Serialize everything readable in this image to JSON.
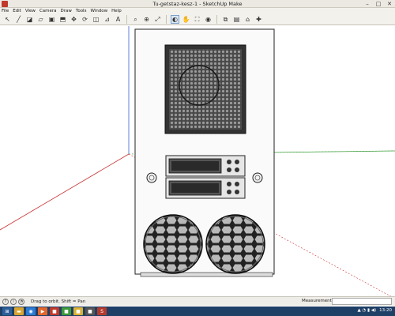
{
  "window": {
    "title": "Tu-getstaz-kesz-1 - SketchUp Make",
    "minimize": "–",
    "maximize": "□",
    "close": "✕"
  },
  "menu": [
    "File",
    "Edit",
    "View",
    "Camera",
    "Draw",
    "Tools",
    "Window",
    "Help"
  ],
  "toolbar": {
    "tools": [
      {
        "name": "select-tool",
        "icon": "↖"
      },
      {
        "name": "line-tool",
        "icon": "╱"
      },
      {
        "name": "shape-tool",
        "icon": "◪"
      },
      {
        "name": "eraser-tool",
        "icon": "▱"
      },
      {
        "name": "paint-tool",
        "icon": "▣"
      },
      {
        "name": "push-pull-tool",
        "icon": "⬒"
      },
      {
        "name": "move-tool",
        "icon": "✥"
      },
      {
        "name": "rotate-tool",
        "icon": "⟳"
      },
      {
        "name": "offset-tool",
        "icon": "◫"
      },
      {
        "name": "tape-tool",
        "icon": "⊿"
      },
      {
        "name": "text-tool",
        "icon": "A"
      },
      {
        "name": "zoom-tool",
        "icon": "⌕"
      },
      {
        "name": "zoom-window-tool",
        "icon": "⊕"
      },
      {
        "name": "zoom-extents-tool",
        "icon": "⤢"
      },
      {
        "name": "orbit-tool",
        "icon": "◐"
      },
      {
        "name": "pan-tool",
        "icon": "✋"
      },
      {
        "name": "walk-tool",
        "icon": "⛶"
      },
      {
        "name": "position-camera-tool",
        "icon": "◉"
      },
      {
        "name": "section-tool",
        "icon": "⧉"
      },
      {
        "name": "scenes-tool",
        "icon": "▤"
      },
      {
        "name": "warehouse-tool",
        "icon": "⌂"
      },
      {
        "name": "extensions-tool",
        "icon": "✚"
      }
    ],
    "active_tool": "orbit-tool"
  },
  "statusbar": {
    "hint": "Drag to orbit.  Shift = Pan",
    "measurements_label": "Measurements",
    "measurements_value": ""
  },
  "taskbar": {
    "apps": [
      {
        "name": "start",
        "icon": "⊞",
        "color": "#2d5f99"
      },
      {
        "name": "explorer",
        "icon": "▬",
        "color": "#d8a531"
      },
      {
        "name": "browser",
        "icon": "◉",
        "color": "#2c7bd6"
      },
      {
        "name": "media",
        "icon": "▶",
        "color": "#e2662c"
      },
      {
        "name": "app-red",
        "icon": "■",
        "color": "#c0392b"
      },
      {
        "name": "app-green",
        "icon": "■",
        "color": "#3f9a3a"
      },
      {
        "name": "app-yellow",
        "icon": "■",
        "color": "#d9b236"
      },
      {
        "name": "app-dark",
        "icon": "■",
        "color": "#555"
      },
      {
        "name": "sketchup",
        "icon": "S",
        "color": "#b43a2d"
      }
    ],
    "clock": "13:20",
    "tray_icons": "▲ ◔ ▮ ◀)"
  }
}
